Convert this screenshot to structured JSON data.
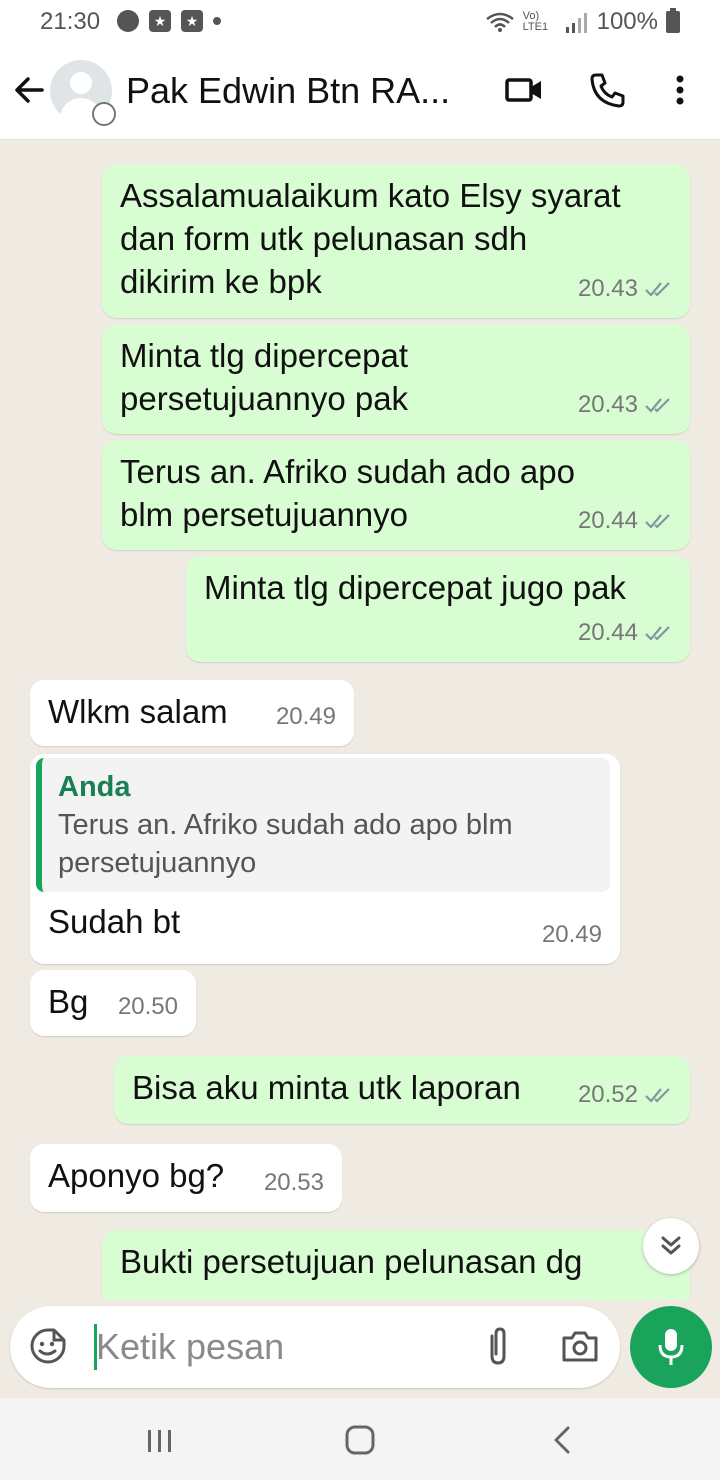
{
  "status_bar": {
    "time": "21:30",
    "battery": "100%",
    "volte": "Vo) LTE1"
  },
  "header": {
    "contact_name": "Pak Edwin Btn RA...",
    "icons": [
      "back-arrow-icon",
      "avatar",
      "video-call-icon",
      "phone-icon",
      "more-icon"
    ]
  },
  "messages": [
    {
      "dir": "out",
      "text": "Assalamualaikum kato Elsy syarat\ndan form utk pelunasan sdh\ndikirim ke bpk",
      "time": "20.43",
      "read": true
    },
    {
      "dir": "out",
      "text": "Minta tlg dipercepat\npersetujuannyo pak",
      "time": "20.43",
      "read": true
    },
    {
      "dir": "out",
      "text": "Terus an. Afriko sudah ado apo\nblm persetujuannyo",
      "time": "20.44",
      "read": true
    },
    {
      "dir": "out",
      "text": "Minta tlg dipercepat jugo pak",
      "time": "20.44",
      "read": true
    },
    {
      "dir": "in",
      "text": "Wlkm salam",
      "time": "20.49"
    },
    {
      "dir": "in",
      "quote_author": "Anda",
      "quote_text": "Terus an. Afriko sudah ado apo blm\npersetujuannyo",
      "text": "Sudah bt",
      "time": "20.49"
    },
    {
      "dir": "in",
      "text": "Bg",
      "time": "20.50"
    },
    {
      "dir": "out",
      "text": "Bisa aku minta utk laporan",
      "time": "20.52",
      "read": true
    },
    {
      "dir": "in",
      "text": "Aponyo bg?",
      "time": "20.53"
    },
    {
      "dir": "out",
      "text": "Bukti persetujuan pelunasan dg",
      "time": "",
      "read": false
    }
  ],
  "input": {
    "placeholder": "Ketik pesan"
  },
  "colors": {
    "outgoing_bubble": "#d9fdd3",
    "incoming_bubble": "#ffffff",
    "accent": "#1aa35a",
    "read_ticks": "#8696a0"
  }
}
